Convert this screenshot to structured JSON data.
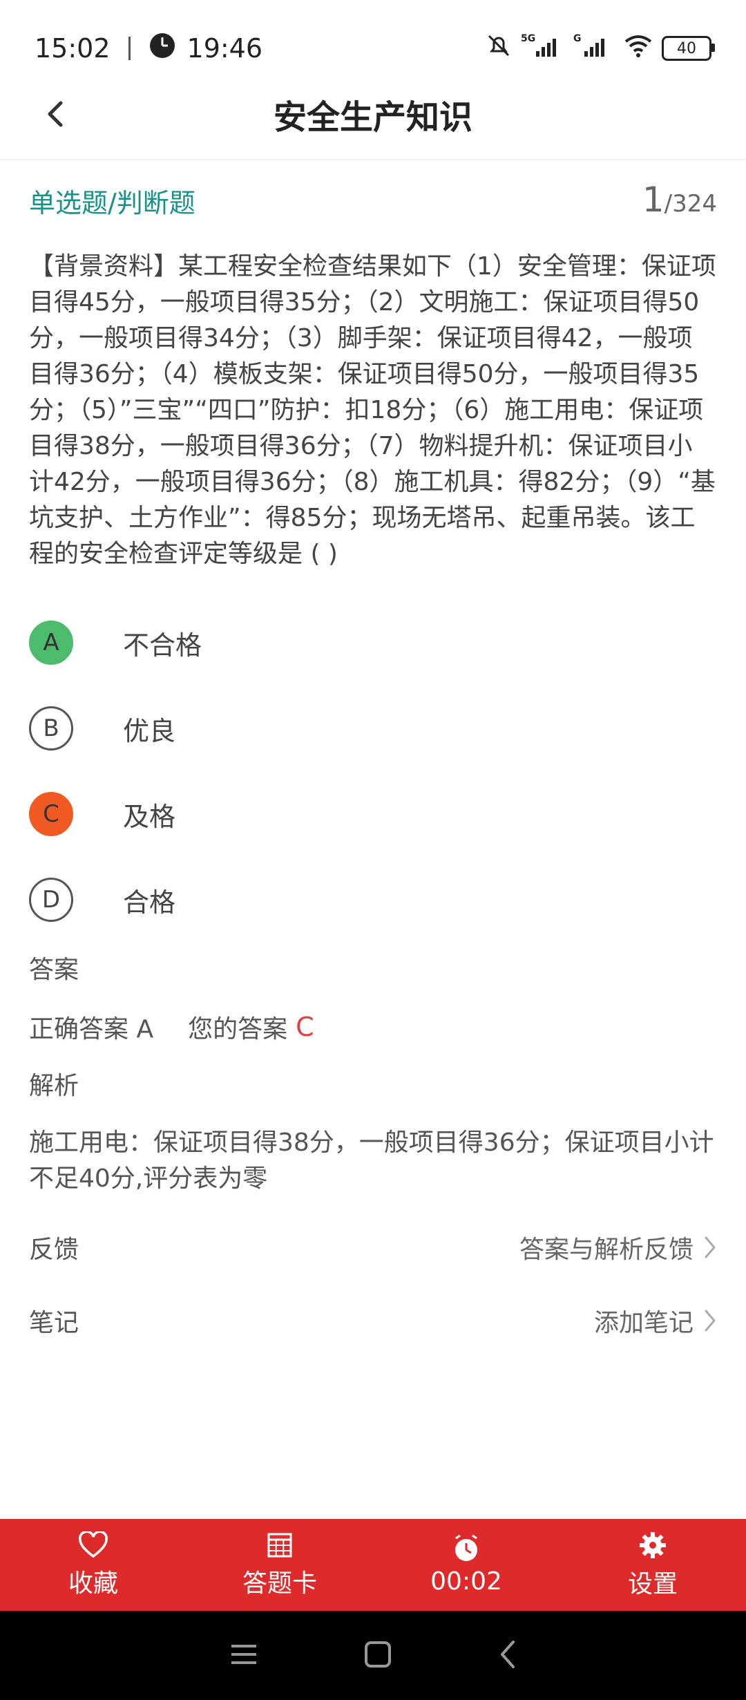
{
  "status": {
    "time": "15:02",
    "clock": "19:46",
    "net1": "5G",
    "net2": "G",
    "battery": "40"
  },
  "header": {
    "title": "安全生产知识"
  },
  "question": {
    "type": "单选题/判断题",
    "current": "1",
    "total": "/324",
    "text": "【背景资料】某工程安全检查结果如下（1）安全管理：保证项目得45分，一般项目得35分；（2）文明施工：保证项目得50分，一般项目得34分；（3）脚手架：保证项目得42，一般项目得36分；（4）模板支架：保证项目得50分，一般项目得35分；（5）”三宝”“四口”防护：扣18分；（6）施工用电：保证项目得38分，一般项目得36分；（7）物料提升机：保证项目小计42分，一般项目得36分；（8）施工机具：得82分；（9）“基坑支护、土方作业”：得85分；现场无塔吊、起重吊装。该工程的安全检查评定等级是 ( )"
  },
  "options": [
    {
      "letter": "A",
      "text": "不合格",
      "state": "correct"
    },
    {
      "letter": "B",
      "text": "优良",
      "state": "none"
    },
    {
      "letter": "C",
      "text": "及格",
      "state": "wrong"
    },
    {
      "letter": "D",
      "text": "合格",
      "state": "none"
    }
  ],
  "answer": {
    "label": "答案",
    "correct_label": "正确答案 A",
    "yours_label": "您的答案",
    "yours_value": "C"
  },
  "analysis": {
    "label": "解析",
    "text": "施工用电：保证项目得38分，一般项目得36分；保证项目小计不足40分,评分表为零"
  },
  "feedback": {
    "label": "反馈",
    "action": "答案与解析反馈"
  },
  "notes": {
    "label": "笔记",
    "action": "添加笔记"
  },
  "tabs": [
    {
      "label": "收藏",
      "icon": "heart-icon"
    },
    {
      "label": "答题卡",
      "icon": "grid-icon"
    },
    {
      "label": "00:02",
      "icon": "clock-icon"
    },
    {
      "label": "设置",
      "icon": "gear-icon"
    }
  ],
  "colors": {
    "accent": "#de2a2a",
    "correct": "#4cbb6c",
    "wrong": "#f25a23",
    "type": "#17918a"
  }
}
